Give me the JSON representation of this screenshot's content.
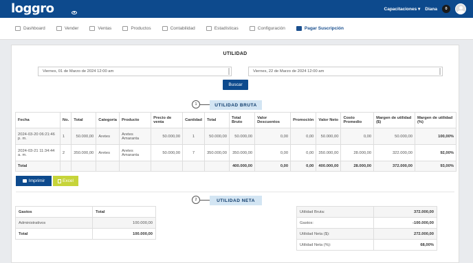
{
  "brand": {
    "logo": "loggro",
    "sub": "POS Tienda"
  },
  "topbar": {
    "capacitaciones": "Capacitaciones ▾",
    "user": "Diana",
    "notifications": "0"
  },
  "nav": [
    {
      "label": "Dashboard",
      "icon": "dashboard-icon"
    },
    {
      "label": "Vender",
      "icon": "cart-icon"
    },
    {
      "label": "Ventas",
      "icon": "dollar-icon"
    },
    {
      "label": "Productos",
      "icon": "products-icon"
    },
    {
      "label": "Contabilidad",
      "icon": "accounting-icon"
    },
    {
      "label": "Estadísticas",
      "icon": "chart-icon"
    },
    {
      "label": "Configuración",
      "icon": "gear-icon"
    },
    {
      "label": "Pagar Suscripción",
      "icon": "card-icon"
    }
  ],
  "page": {
    "title": "UTILIDAD",
    "date_from": "Viernes, 01 de Marzo de 2024 12:00 am",
    "date_to": "Viernes, 22 de Marzo de 2024 12:00 am",
    "search_label": "Buscar"
  },
  "gross": {
    "number": "1",
    "label": "UTILIDAD BRUTA",
    "headers": [
      "Fecha",
      "No.",
      "Total",
      "Categoría",
      "Producto",
      "Precio de venta",
      "Cantidad",
      "Total",
      "Total Bruto",
      "Valor Descuentos",
      "Promoción",
      "Valor Neto",
      "Costo Promedio",
      "Margen de utilidad ($)",
      "Margen de utilidad (%)"
    ],
    "rows": [
      [
        "2024-03-20 06:21:46 p. m.",
        "1",
        "50.000,00",
        "Aretes",
        "Aretes Amaranta",
        "50.000,00",
        "1",
        "50.000,00",
        "50.000,00",
        "0,00",
        "0,00",
        "50.000,00",
        "0,00",
        "50.000,00",
        "100,00%"
      ],
      [
        "2024-03-21 11:34:44 a. m.",
        "2",
        "350.000,00",
        "Aretes",
        "Aretes Amaranta",
        "50.000,00",
        "7",
        "350.000,00",
        "350.000,00",
        "0,00",
        "0,00",
        "350.000,00",
        "28.000,00",
        "322.000,00",
        "92,00%"
      ]
    ],
    "total": [
      "Total",
      "",
      "",
      "",
      "",
      "",
      "",
      "",
      "400.000,00",
      "0,00",
      "0,00",
      "400.000,00",
      "28.000,00",
      "372.000,00",
      "93,00%"
    ]
  },
  "actions": {
    "print": "Imprimir",
    "excel": "Excel"
  },
  "net": {
    "number": "2",
    "label": "UTILIDAD NETA",
    "expenses_headers": [
      "Gastos",
      "Total"
    ],
    "expenses_rows": [
      [
        "Administrativos",
        "100.000,00"
      ]
    ],
    "expenses_total": [
      "Total",
      "100.000,00"
    ],
    "summary": [
      [
        "Utilidad Bruta:",
        "372.000,00"
      ],
      [
        "Gastos:",
        "-100.000,00"
      ],
      [
        "Utilidad Neta ($):",
        "272.000,00"
      ],
      [
        "Utilidad Neta (%):",
        "68,00%"
      ]
    ]
  },
  "colors": {
    "primary": "#0d4a8d",
    "section_bg": "#d3e5f3",
    "excel": "#c6d43a"
  }
}
